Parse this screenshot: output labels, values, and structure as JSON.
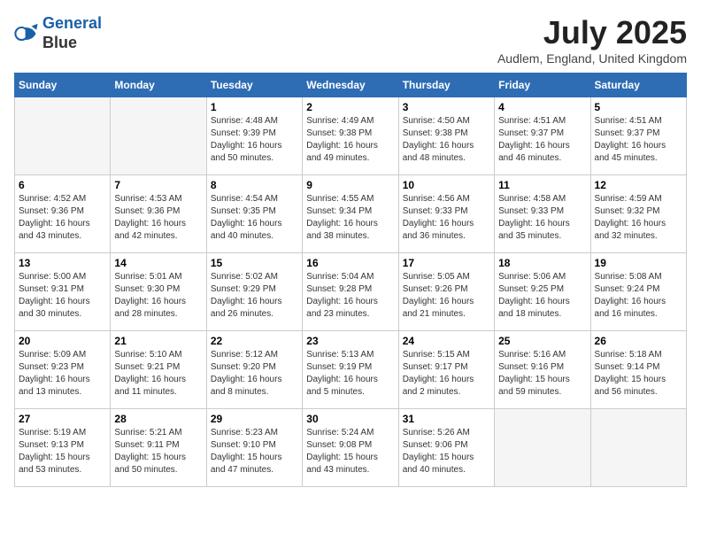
{
  "header": {
    "logo_line1": "General",
    "logo_line2": "Blue",
    "month_year": "July 2025",
    "location": "Audlem, England, United Kingdom"
  },
  "weekdays": [
    "Sunday",
    "Monday",
    "Tuesday",
    "Wednesday",
    "Thursday",
    "Friday",
    "Saturday"
  ],
  "weeks": [
    [
      {
        "day": "",
        "detail": ""
      },
      {
        "day": "",
        "detail": ""
      },
      {
        "day": "1",
        "detail": "Sunrise: 4:48 AM\nSunset: 9:39 PM\nDaylight: 16 hours\nand 50 minutes."
      },
      {
        "day": "2",
        "detail": "Sunrise: 4:49 AM\nSunset: 9:38 PM\nDaylight: 16 hours\nand 49 minutes."
      },
      {
        "day": "3",
        "detail": "Sunrise: 4:50 AM\nSunset: 9:38 PM\nDaylight: 16 hours\nand 48 minutes."
      },
      {
        "day": "4",
        "detail": "Sunrise: 4:51 AM\nSunset: 9:37 PM\nDaylight: 16 hours\nand 46 minutes."
      },
      {
        "day": "5",
        "detail": "Sunrise: 4:51 AM\nSunset: 9:37 PM\nDaylight: 16 hours\nand 45 minutes."
      }
    ],
    [
      {
        "day": "6",
        "detail": "Sunrise: 4:52 AM\nSunset: 9:36 PM\nDaylight: 16 hours\nand 43 minutes."
      },
      {
        "day": "7",
        "detail": "Sunrise: 4:53 AM\nSunset: 9:36 PM\nDaylight: 16 hours\nand 42 minutes."
      },
      {
        "day": "8",
        "detail": "Sunrise: 4:54 AM\nSunset: 9:35 PM\nDaylight: 16 hours\nand 40 minutes."
      },
      {
        "day": "9",
        "detail": "Sunrise: 4:55 AM\nSunset: 9:34 PM\nDaylight: 16 hours\nand 38 minutes."
      },
      {
        "day": "10",
        "detail": "Sunrise: 4:56 AM\nSunset: 9:33 PM\nDaylight: 16 hours\nand 36 minutes."
      },
      {
        "day": "11",
        "detail": "Sunrise: 4:58 AM\nSunset: 9:33 PM\nDaylight: 16 hours\nand 35 minutes."
      },
      {
        "day": "12",
        "detail": "Sunrise: 4:59 AM\nSunset: 9:32 PM\nDaylight: 16 hours\nand 32 minutes."
      }
    ],
    [
      {
        "day": "13",
        "detail": "Sunrise: 5:00 AM\nSunset: 9:31 PM\nDaylight: 16 hours\nand 30 minutes."
      },
      {
        "day": "14",
        "detail": "Sunrise: 5:01 AM\nSunset: 9:30 PM\nDaylight: 16 hours\nand 28 minutes."
      },
      {
        "day": "15",
        "detail": "Sunrise: 5:02 AM\nSunset: 9:29 PM\nDaylight: 16 hours\nand 26 minutes."
      },
      {
        "day": "16",
        "detail": "Sunrise: 5:04 AM\nSunset: 9:28 PM\nDaylight: 16 hours\nand 23 minutes."
      },
      {
        "day": "17",
        "detail": "Sunrise: 5:05 AM\nSunset: 9:26 PM\nDaylight: 16 hours\nand 21 minutes."
      },
      {
        "day": "18",
        "detail": "Sunrise: 5:06 AM\nSunset: 9:25 PM\nDaylight: 16 hours\nand 18 minutes."
      },
      {
        "day": "19",
        "detail": "Sunrise: 5:08 AM\nSunset: 9:24 PM\nDaylight: 16 hours\nand 16 minutes."
      }
    ],
    [
      {
        "day": "20",
        "detail": "Sunrise: 5:09 AM\nSunset: 9:23 PM\nDaylight: 16 hours\nand 13 minutes."
      },
      {
        "day": "21",
        "detail": "Sunrise: 5:10 AM\nSunset: 9:21 PM\nDaylight: 16 hours\nand 11 minutes."
      },
      {
        "day": "22",
        "detail": "Sunrise: 5:12 AM\nSunset: 9:20 PM\nDaylight: 16 hours\nand 8 minutes."
      },
      {
        "day": "23",
        "detail": "Sunrise: 5:13 AM\nSunset: 9:19 PM\nDaylight: 16 hours\nand 5 minutes."
      },
      {
        "day": "24",
        "detail": "Sunrise: 5:15 AM\nSunset: 9:17 PM\nDaylight: 16 hours\nand 2 minutes."
      },
      {
        "day": "25",
        "detail": "Sunrise: 5:16 AM\nSunset: 9:16 PM\nDaylight: 15 hours\nand 59 minutes."
      },
      {
        "day": "26",
        "detail": "Sunrise: 5:18 AM\nSunset: 9:14 PM\nDaylight: 15 hours\nand 56 minutes."
      }
    ],
    [
      {
        "day": "27",
        "detail": "Sunrise: 5:19 AM\nSunset: 9:13 PM\nDaylight: 15 hours\nand 53 minutes."
      },
      {
        "day": "28",
        "detail": "Sunrise: 5:21 AM\nSunset: 9:11 PM\nDaylight: 15 hours\nand 50 minutes."
      },
      {
        "day": "29",
        "detail": "Sunrise: 5:23 AM\nSunset: 9:10 PM\nDaylight: 15 hours\nand 47 minutes."
      },
      {
        "day": "30",
        "detail": "Sunrise: 5:24 AM\nSunset: 9:08 PM\nDaylight: 15 hours\nand 43 minutes."
      },
      {
        "day": "31",
        "detail": "Sunrise: 5:26 AM\nSunset: 9:06 PM\nDaylight: 15 hours\nand 40 minutes."
      },
      {
        "day": "",
        "detail": ""
      },
      {
        "day": "",
        "detail": ""
      }
    ]
  ]
}
